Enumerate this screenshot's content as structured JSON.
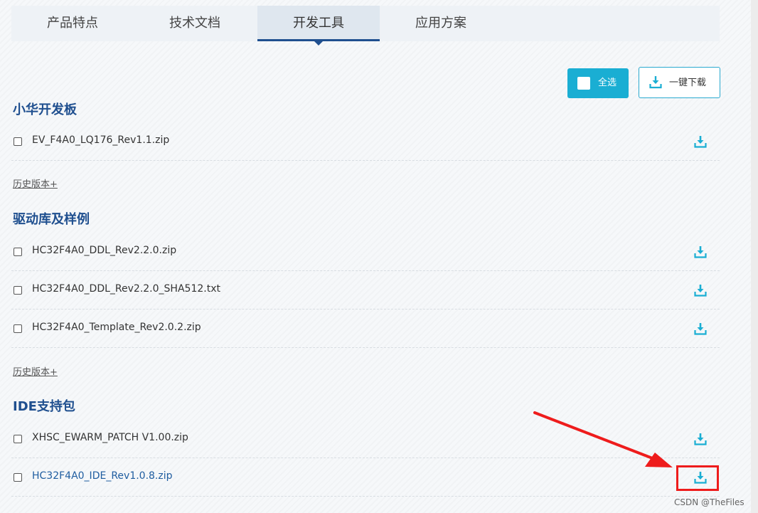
{
  "tabs": [
    {
      "label": "产品特点",
      "active": false
    },
    {
      "label": "技术文档",
      "active": false
    },
    {
      "label": "开发工具",
      "active": true
    },
    {
      "label": "应用方案",
      "active": false
    }
  ],
  "actions": {
    "select_all_label": "全选",
    "download_all_label": "一键下载"
  },
  "colors": {
    "brand_blue": "#1f4f8f",
    "accent_cyan": "#1aaed3",
    "highlight_red": "#ee1c1c"
  },
  "sections": [
    {
      "title": "小华开发板",
      "files": [
        "EV_F4A0_LQ176_Rev1.1.zip"
      ],
      "history_label": "历史版本+"
    },
    {
      "title": "驱动库及样例",
      "files": [
        "HC32F4A0_DDL_Rev2.2.0.zip",
        "HC32F4A0_DDL_Rev2.2.0_SHA512.txt",
        "HC32F4A0_Template_Rev2.0.2.zip"
      ],
      "history_label": "历史版本+"
    },
    {
      "title": "IDE支持包",
      "files": [
        "XHSC_EWARM_PATCH V1.00.zip",
        "HC32F4A0_IDE_Rev1.0.8.zip"
      ]
    }
  ],
  "icons": {
    "download": "download-icon",
    "checkbox": "checkbox-icon",
    "arrow": "red-arrow-annotation"
  },
  "watermark": "CSDN @TheFiles"
}
